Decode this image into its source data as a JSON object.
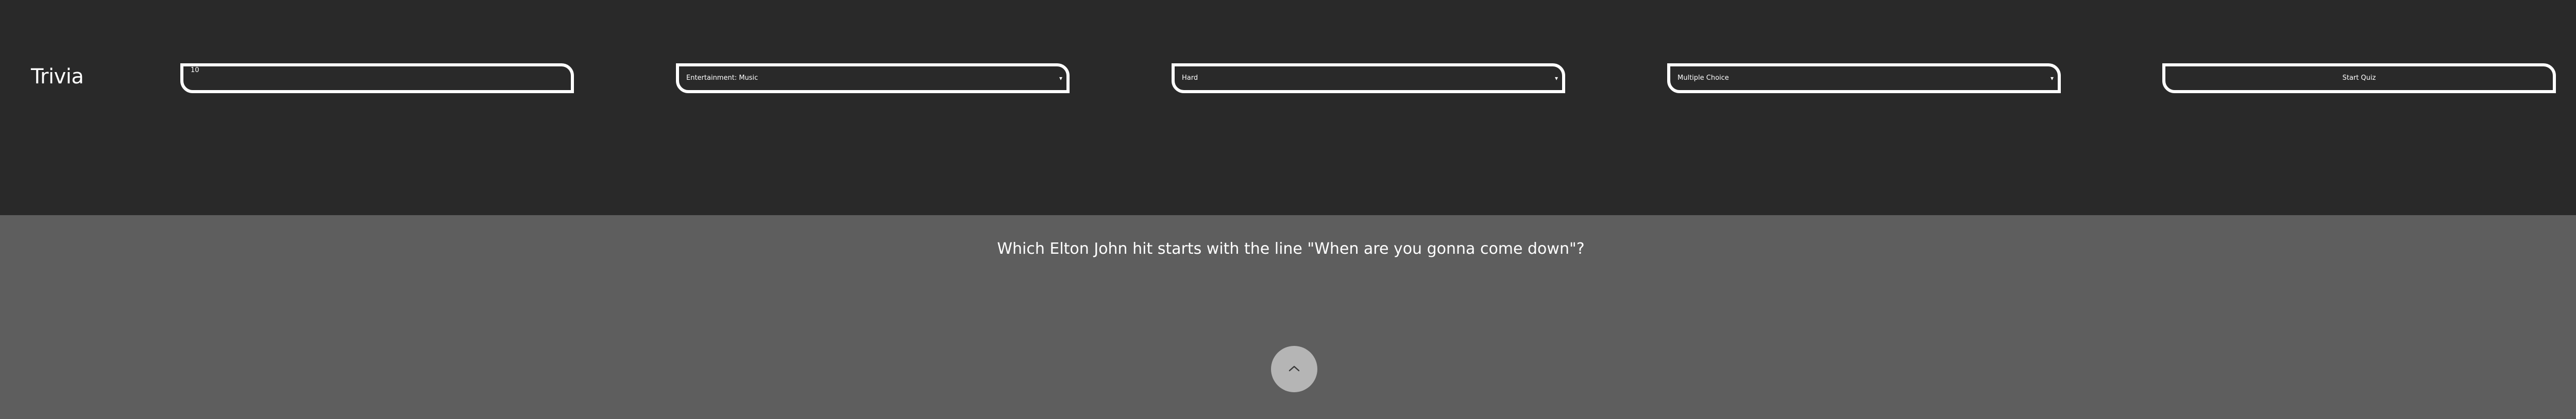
{
  "brand": {
    "title": "Trivia"
  },
  "controls": {
    "amount_value": "10",
    "category_selected": "Entertainment: Music",
    "difficulty_selected": "Hard",
    "type_selected": "Multiple Choice",
    "start_label": "Start Quiz"
  },
  "question": {
    "text": "Which Elton John hit starts with the line \"When are you gonna come down\"?"
  },
  "icons": {
    "dropdown": "chevron-down-icon",
    "scroll_top": "chevron-up-icon"
  },
  "colors": {
    "header_bg": "#292929",
    "main_bg": "#5e5e5e",
    "text": "#ffffff",
    "scroll_button_bg": "#b5b5b5"
  }
}
